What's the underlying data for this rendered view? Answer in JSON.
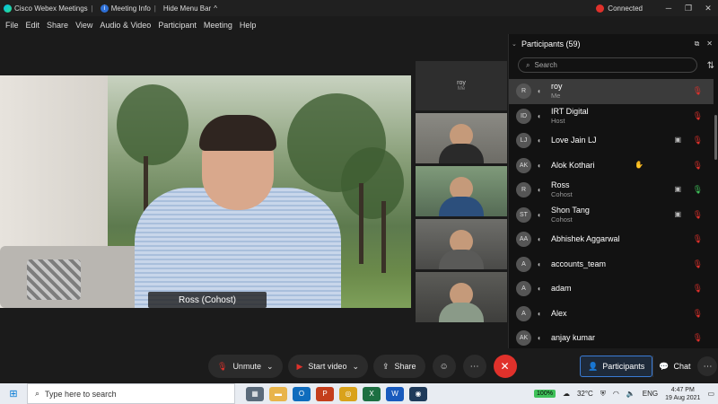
{
  "titlebar": {
    "app": "Cisco Webex Meetings",
    "meeting_info": "Meeting Info",
    "hide_menu": "Hide Menu Bar",
    "hide_menu_chevron": "^",
    "status": "Connected"
  },
  "menu": [
    "File",
    "Edit",
    "Share",
    "View",
    "Audio & Video",
    "Participant",
    "Meeting",
    "Help"
  ],
  "stage": {
    "name_label": "Ross (Cohost)"
  },
  "self_thumb": {
    "name": "roy",
    "sub": "Me"
  },
  "panel": {
    "title": "Participants (59)",
    "search_placeholder": "Search",
    "participants": [
      {
        "initials": "R",
        "name": "roy",
        "role": "Me",
        "mic": "muted"
      },
      {
        "initials": "ID",
        "name": "IRT Digital",
        "role": "Host",
        "mic": "muted"
      },
      {
        "initials": "LJ",
        "name": "Love Jain LJ",
        "role": "",
        "mic": "muted",
        "cam": true
      },
      {
        "initials": "AK",
        "name": "Alok Kothari",
        "role": "",
        "mic": "muted",
        "mid": true
      },
      {
        "initials": "R",
        "name": "Ross",
        "role": "Cohost",
        "mic": "on",
        "cam": true
      },
      {
        "initials": "ST",
        "name": "Shon Tang",
        "role": "Cohost",
        "mic": "muted",
        "cam": true
      },
      {
        "initials": "AA",
        "name": "Abhishek Aggarwal",
        "role": "",
        "mic": "muted"
      },
      {
        "initials": "A",
        "name": "accounts_team",
        "role": "",
        "mic": "muted"
      },
      {
        "initials": "A",
        "name": "adam",
        "role": "",
        "mic": "muted"
      },
      {
        "initials": "A",
        "name": "Alex",
        "role": "",
        "mic": "muted"
      },
      {
        "initials": "AK",
        "name": "anjay kumar",
        "role": "",
        "mic": "muted"
      }
    ]
  },
  "controls": {
    "unmute": "Unmute",
    "start_video": "Start video",
    "share": "Share",
    "participants": "Participants",
    "chat": "Chat"
  },
  "taskbar": {
    "search": "Type here to search",
    "battery": "100%",
    "temp": "32°C",
    "lang": "ENG",
    "time": "4:47 PM",
    "date": "19 Aug 2021"
  },
  "colors": {
    "accent": "#3a7bd5",
    "end": "#e0312b",
    "muted": "#e0312b",
    "speaking": "#3fc15a"
  }
}
